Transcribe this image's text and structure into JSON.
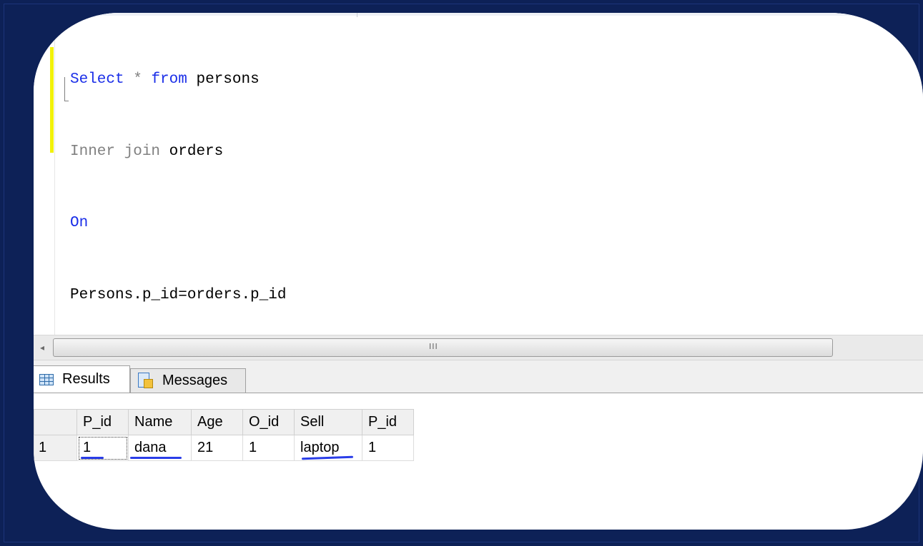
{
  "editor": {
    "lines": [
      [
        {
          "text": "Select",
          "style": "kw"
        },
        {
          "text": " * ",
          "style": "gray"
        },
        {
          "text": "from",
          "style": "kw"
        },
        {
          "text": " persons",
          "style": "plain"
        }
      ],
      [
        {
          "text": "Inner join",
          "style": "gray"
        },
        {
          "text": " orders",
          "style": "plain"
        }
      ],
      [
        {
          "text": "On",
          "style": "kw"
        }
      ],
      [
        {
          "text": "Persons.p_id=orders.p_id",
          "style": "plain"
        }
      ]
    ]
  },
  "scrollbar": {
    "grip": "III"
  },
  "tabs": {
    "results": "Results",
    "messages": "Messages"
  },
  "grid": {
    "columns": [
      "P_id",
      "Name",
      "Age",
      "O_id",
      "Sell",
      "P_id"
    ],
    "rows": [
      {
        "row_number": "1",
        "cells": [
          "1",
          "dana",
          "21",
          "1",
          "laptop",
          "1"
        ]
      }
    ]
  },
  "colors": {
    "keyword": "#1a2ee8",
    "operator": "#808080",
    "change_marker": "#f2f20a",
    "background": "#0d2157",
    "annotation_ink": "#2a3de8"
  }
}
